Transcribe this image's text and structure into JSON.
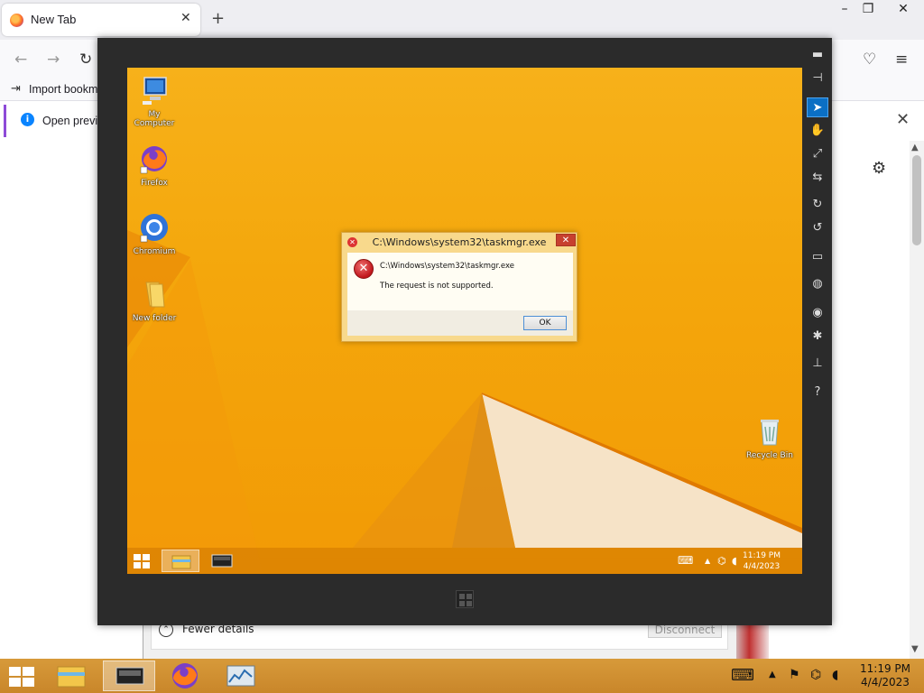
{
  "browser": {
    "tab_title": "New Tab",
    "tab_close_glyph": "✕",
    "new_tab_glyph": "+",
    "import_bookmarks": "Import bookm",
    "info_text": "Open previo",
    "info_close_glyph": "✕"
  },
  "background_dialog": {
    "fewer_details": "Fewer details",
    "disconnect": "Disconnect"
  },
  "remote_desktop": {
    "icons": [
      {
        "label": "My Computer"
      },
      {
        "label": "Firefox"
      },
      {
        "label": "Chromium"
      },
      {
        "label": "New folder"
      },
      {
        "label": "Recycle Bin"
      }
    ],
    "error_dialog": {
      "title": "C:\\Windows\\system32\\taskmgr.exe",
      "path": "C:\\Windows\\system32\\taskmgr.exe",
      "message": "The request is not supported.",
      "ok_label": "OK",
      "close_glyph": "✕"
    },
    "taskbar": {
      "time": "11:19 PM",
      "date": "4/4/2023"
    }
  },
  "host_taskbar": {
    "time": "11:19 PM",
    "date": "4/4/2023"
  },
  "viewer_toolbar": [
    {
      "name": "minimize-icon",
      "glyph": "▬"
    },
    {
      "name": "pin-icon",
      "glyph": "⊣"
    },
    {
      "name": "pointer-icon",
      "glyph": "➤"
    },
    {
      "name": "hand-icon",
      "glyph": "✋"
    },
    {
      "name": "fit-screen-icon",
      "glyph": "⤢"
    },
    {
      "name": "swap-icon",
      "glyph": "⇆"
    },
    {
      "name": "rotate-right-icon",
      "glyph": "↻"
    },
    {
      "name": "rotate-left-icon",
      "glyph": "↺"
    },
    {
      "name": "monitor-icon",
      "glyph": "▭"
    },
    {
      "name": "globe-icon",
      "glyph": "◍"
    },
    {
      "name": "camera-icon",
      "glyph": "◉"
    },
    {
      "name": "settings-icon",
      "glyph": "✱"
    },
    {
      "name": "keyboard-shortcut-icon",
      "glyph": "⊥"
    },
    {
      "name": "help-icon",
      "glyph": "?"
    }
  ],
  "colors": {
    "desktop_orange": "#f4a70c",
    "toolbar_active": "#0b6fc4",
    "dialog_frame": "#f8d98c",
    "error_red": "#c0161c"
  }
}
